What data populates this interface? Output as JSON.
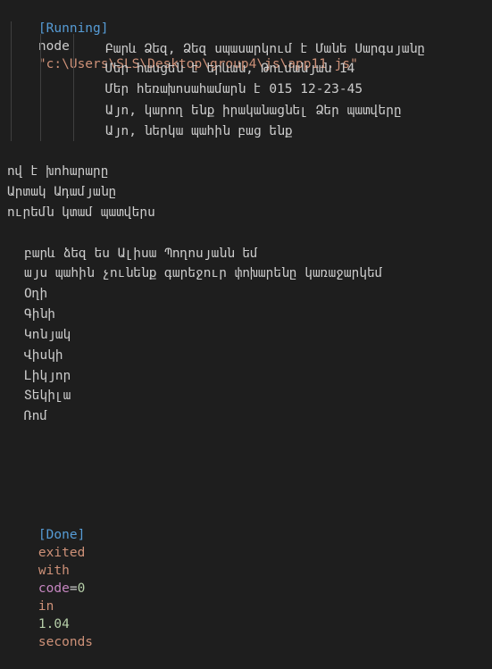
{
  "header": {
    "status": "[Running]",
    "command": "node",
    "path": "\"c:\\Users\\SLS\\Desktop\\group4\\js\\app11.js\""
  },
  "block1": [
    "Բարև Ձեզ, Ձեզ սպասարկում է Մանե Սարգսյանը",
    "Մեր հասցեն է երևան, Թումանյան 14",
    "Մեր հեռախոսահամարն է 015 12-23-45",
    "Այո, կարող ենք իրականացնել Ձեր պատվերը",
    "Այո, ներկա պահին բաց ենք"
  ],
  "block2": [
    "ով է խոհարարը",
    "Արտակ Ադամյանը",
    "ուրեմն կտամ պատվերս"
  ],
  "block3": [
    "բարև ձեզ ես Ալիսա Պողոսյանն եմ",
    "այս պահին չունենք գարեջուր փոխարենը կառաջարկեմ",
    "Օղի",
    "Գինի",
    "Կոնյակ",
    "Վիսկի",
    "Լիկյոր",
    "Տեկիլա",
    "Ռոմ"
  ],
  "footer": {
    "status": "[Done]",
    "word_exited": "exited",
    "word_with": "with",
    "code_key": "code",
    "equals": "=",
    "code_value": "0",
    "word_in": "in",
    "duration": "1.04",
    "word_seconds": "seconds"
  }
}
